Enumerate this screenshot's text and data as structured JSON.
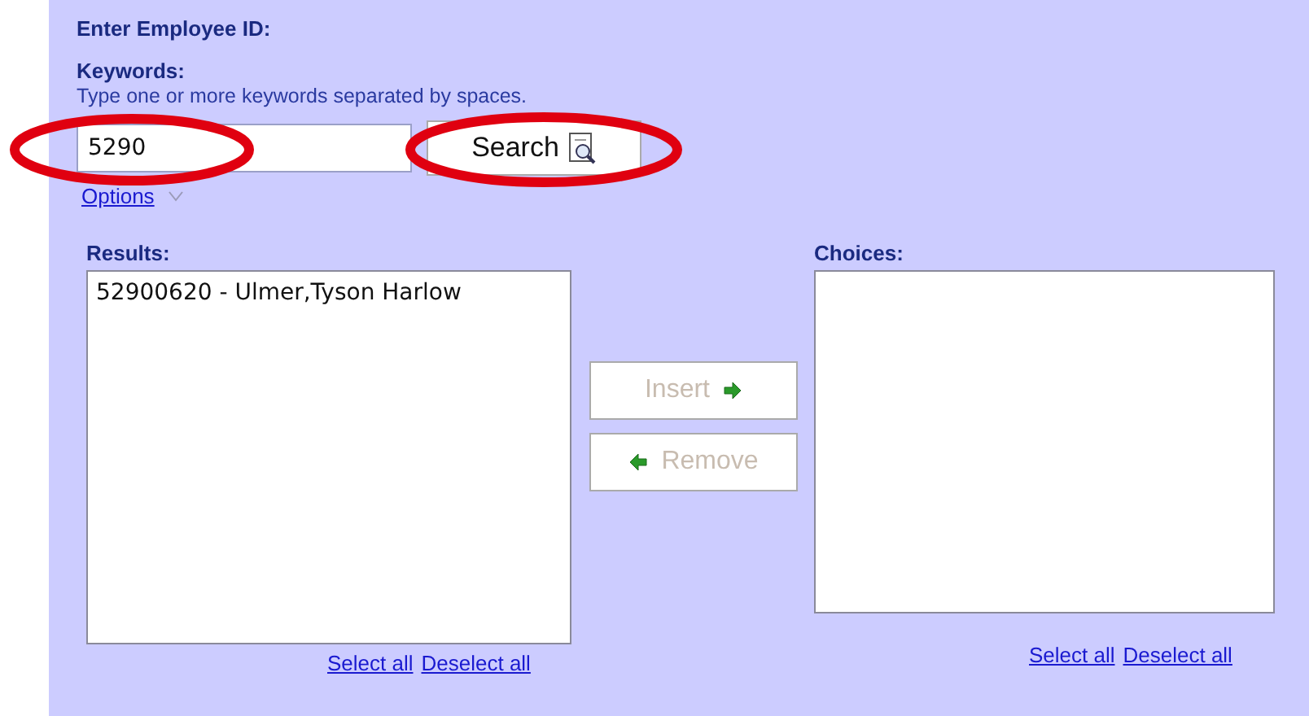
{
  "title": "Enter Employee ID:",
  "keywords": {
    "label": "Keywords:",
    "hint": "Type one or more keywords separated by spaces.",
    "value": "5290",
    "circled": true
  },
  "search_button": {
    "label": "Search",
    "circled": true
  },
  "options_link": "Options",
  "results": {
    "label": "Results:",
    "items": [
      {
        "text": "52900620 - Ulmer,Tyson Harlow",
        "selected": false
      }
    ],
    "links": [
      "Select all",
      "Deselect all"
    ]
  },
  "actions": [
    {
      "label": "Insert",
      "kind": "insert",
      "disabled": true
    },
    {
      "label": "Remove",
      "kind": "remove",
      "disabled": true
    }
  ],
  "choices": {
    "label": "Choices:",
    "links": [
      "Select all",
      "Deselect all"
    ]
  }
}
